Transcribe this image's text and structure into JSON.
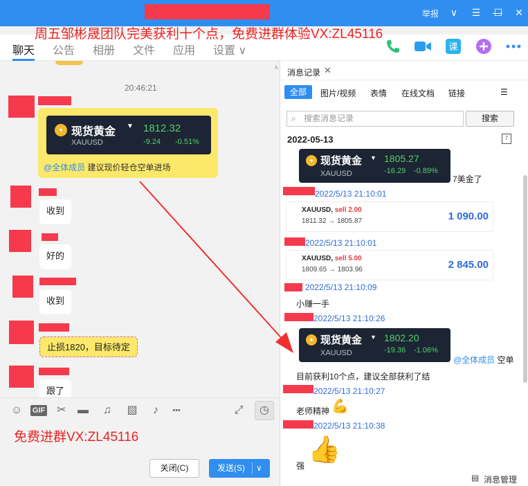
{
  "window": {
    "report": "举报",
    "controls": {
      "dropdown": "∨",
      "menu": "☰",
      "minimize": "—",
      "maximize": "☐",
      "close": "✕"
    }
  },
  "banner": "周五邹彬晟团队完美获利十个点，免费进群体验VX:ZL45116",
  "tabs": [
    "聊天",
    "公告",
    "相册",
    "文件",
    "应用",
    "设置 ∨"
  ],
  "chat": {
    "time": "20:46:21",
    "gold_card": {
      "name": "现货黄金",
      "symbol": "XAUUSD",
      "price": "1812.32",
      "change": "-9.24",
      "change_pct": "-0.51%",
      "mention": "@全体成员",
      "text": "建议现价轻仓空单进场"
    },
    "messages": [
      {
        "text": "收到"
      },
      {
        "text": "好的"
      },
      {
        "text": "收到"
      },
      {
        "text": "止损1820，目标待定"
      },
      {
        "text": "跟了"
      }
    ]
  },
  "toolbar": {
    "icons": [
      "emoji-icon",
      "gif-icon",
      "scissors-icon",
      "folder-icon",
      "shake-icon",
      "image-icon",
      "bell-icon",
      "more-icon",
      "expand-icon",
      "history-icon"
    ],
    "gif": "GIF",
    "more": "•••"
  },
  "input": {
    "text": "免费进群VX:ZL45116"
  },
  "buttons": {
    "close": "关闭(C)",
    "send": "发送(S)",
    "send_arrow": "∨"
  },
  "history": {
    "title": "消息记录",
    "close": "✕",
    "tabs": [
      "全部",
      "图片/视频",
      "表情",
      "在线文档",
      "链接"
    ],
    "search_placeholder": "搜索消息记录",
    "search_btn": "搜索",
    "date": "2022-05-13",
    "card1": {
      "name": "现货黄金",
      "symbol": "XAUUSD",
      "price": "1805.27",
      "change": "-16.29",
      "change_pct": "-0.89%",
      "suffix": "7美金了"
    },
    "entries": [
      {
        "time": "2022/5/13 21:10:01"
      },
      {
        "time": "2022/5/13 21:10:01"
      },
      {
        "time": "2022/5/13 21:10:09"
      },
      {
        "time": "2022/5/13 21:10:26"
      },
      {
        "time": "2022/5/13 21:10:27"
      },
      {
        "time": "2022/5/13 21:10:38"
      }
    ],
    "trade1": {
      "sym": "XAUUSD,",
      "side": "sell 2.00",
      "path": "1811.32 → 1805.87",
      "amount": "1 090.00"
    },
    "trade2": {
      "sym": "XAUUSD,",
      "side": "sell 5.00",
      "path": "1809.65 → 1803.96",
      "amount": "2 845.00"
    },
    "text1": "小赚一手",
    "card2": {
      "name": "现货黄金",
      "symbol": "XAUUSD",
      "price": "1802.20",
      "change": "-19.36",
      "change_pct": "-1.06%",
      "mention": "@全体成员",
      "suffix": "空单"
    },
    "text2": "目前获利10个点，建议全部获利了结",
    "text3": "老师精神",
    "text4": "强",
    "footer": "消息管理"
  },
  "colors": {
    "accent": "#2f8ef0",
    "redaction": "#f53a4e",
    "banner": "#ee2222",
    "ticker_bg": "#1d2433",
    "up_green": "#4fd16a",
    "card_yellow": "#fce86a"
  }
}
